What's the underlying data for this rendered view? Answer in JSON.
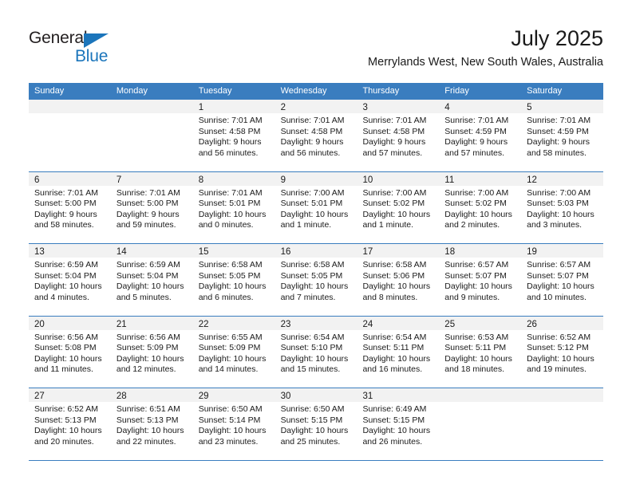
{
  "brand": {
    "name_top": "General",
    "name_bottom": "Blue",
    "triangle_icon": "triangle-icon",
    "color_dark": "#231f20",
    "color_blue": "#1b75bb"
  },
  "header": {
    "title": "July 2025",
    "subtitle": "Merrylands West, New South Wales, Australia"
  },
  "theme": {
    "header_blue": "#3a7dbf",
    "daynum_strip": "#f2f2f2",
    "text": "#1a1a1a"
  },
  "weekdays": [
    "Sunday",
    "Monday",
    "Tuesday",
    "Wednesday",
    "Thursday",
    "Friday",
    "Saturday"
  ],
  "weeks": [
    {
      "days": [
        {
          "num": "",
          "sunrise": "",
          "sunset": "",
          "daylight_l1": "",
          "daylight_l2": ""
        },
        {
          "num": "",
          "sunrise": "",
          "sunset": "",
          "daylight_l1": "",
          "daylight_l2": ""
        },
        {
          "num": "1",
          "sunrise": "Sunrise: 7:01 AM",
          "sunset": "Sunset: 4:58 PM",
          "daylight_l1": "Daylight: 9 hours",
          "daylight_l2": "and 56 minutes."
        },
        {
          "num": "2",
          "sunrise": "Sunrise: 7:01 AM",
          "sunset": "Sunset: 4:58 PM",
          "daylight_l1": "Daylight: 9 hours",
          "daylight_l2": "and 56 minutes."
        },
        {
          "num": "3",
          "sunrise": "Sunrise: 7:01 AM",
          "sunset": "Sunset: 4:58 PM",
          "daylight_l1": "Daylight: 9 hours",
          "daylight_l2": "and 57 minutes."
        },
        {
          "num": "4",
          "sunrise": "Sunrise: 7:01 AM",
          "sunset": "Sunset: 4:59 PM",
          "daylight_l1": "Daylight: 9 hours",
          "daylight_l2": "and 57 minutes."
        },
        {
          "num": "5",
          "sunrise": "Sunrise: 7:01 AM",
          "sunset": "Sunset: 4:59 PM",
          "daylight_l1": "Daylight: 9 hours",
          "daylight_l2": "and 58 minutes."
        }
      ]
    },
    {
      "days": [
        {
          "num": "6",
          "sunrise": "Sunrise: 7:01 AM",
          "sunset": "Sunset: 5:00 PM",
          "daylight_l1": "Daylight: 9 hours",
          "daylight_l2": "and 58 minutes."
        },
        {
          "num": "7",
          "sunrise": "Sunrise: 7:01 AM",
          "sunset": "Sunset: 5:00 PM",
          "daylight_l1": "Daylight: 9 hours",
          "daylight_l2": "and 59 minutes."
        },
        {
          "num": "8",
          "sunrise": "Sunrise: 7:01 AM",
          "sunset": "Sunset: 5:01 PM",
          "daylight_l1": "Daylight: 10 hours",
          "daylight_l2": "and 0 minutes."
        },
        {
          "num": "9",
          "sunrise": "Sunrise: 7:00 AM",
          "sunset": "Sunset: 5:01 PM",
          "daylight_l1": "Daylight: 10 hours",
          "daylight_l2": "and 1 minute."
        },
        {
          "num": "10",
          "sunrise": "Sunrise: 7:00 AM",
          "sunset": "Sunset: 5:02 PM",
          "daylight_l1": "Daylight: 10 hours",
          "daylight_l2": "and 1 minute."
        },
        {
          "num": "11",
          "sunrise": "Sunrise: 7:00 AM",
          "sunset": "Sunset: 5:02 PM",
          "daylight_l1": "Daylight: 10 hours",
          "daylight_l2": "and 2 minutes."
        },
        {
          "num": "12",
          "sunrise": "Sunrise: 7:00 AM",
          "sunset": "Sunset: 5:03 PM",
          "daylight_l1": "Daylight: 10 hours",
          "daylight_l2": "and 3 minutes."
        }
      ]
    },
    {
      "days": [
        {
          "num": "13",
          "sunrise": "Sunrise: 6:59 AM",
          "sunset": "Sunset: 5:04 PM",
          "daylight_l1": "Daylight: 10 hours",
          "daylight_l2": "and 4 minutes."
        },
        {
          "num": "14",
          "sunrise": "Sunrise: 6:59 AM",
          "sunset": "Sunset: 5:04 PM",
          "daylight_l1": "Daylight: 10 hours",
          "daylight_l2": "and 5 minutes."
        },
        {
          "num": "15",
          "sunrise": "Sunrise: 6:58 AM",
          "sunset": "Sunset: 5:05 PM",
          "daylight_l1": "Daylight: 10 hours",
          "daylight_l2": "and 6 minutes."
        },
        {
          "num": "16",
          "sunrise": "Sunrise: 6:58 AM",
          "sunset": "Sunset: 5:05 PM",
          "daylight_l1": "Daylight: 10 hours",
          "daylight_l2": "and 7 minutes."
        },
        {
          "num": "17",
          "sunrise": "Sunrise: 6:58 AM",
          "sunset": "Sunset: 5:06 PM",
          "daylight_l1": "Daylight: 10 hours",
          "daylight_l2": "and 8 minutes."
        },
        {
          "num": "18",
          "sunrise": "Sunrise: 6:57 AM",
          "sunset": "Sunset: 5:07 PM",
          "daylight_l1": "Daylight: 10 hours",
          "daylight_l2": "and 9 minutes."
        },
        {
          "num": "19",
          "sunrise": "Sunrise: 6:57 AM",
          "sunset": "Sunset: 5:07 PM",
          "daylight_l1": "Daylight: 10 hours",
          "daylight_l2": "and 10 minutes."
        }
      ]
    },
    {
      "days": [
        {
          "num": "20",
          "sunrise": "Sunrise: 6:56 AM",
          "sunset": "Sunset: 5:08 PM",
          "daylight_l1": "Daylight: 10 hours",
          "daylight_l2": "and 11 minutes."
        },
        {
          "num": "21",
          "sunrise": "Sunrise: 6:56 AM",
          "sunset": "Sunset: 5:09 PM",
          "daylight_l1": "Daylight: 10 hours",
          "daylight_l2": "and 12 minutes."
        },
        {
          "num": "22",
          "sunrise": "Sunrise: 6:55 AM",
          "sunset": "Sunset: 5:09 PM",
          "daylight_l1": "Daylight: 10 hours",
          "daylight_l2": "and 14 minutes."
        },
        {
          "num": "23",
          "sunrise": "Sunrise: 6:54 AM",
          "sunset": "Sunset: 5:10 PM",
          "daylight_l1": "Daylight: 10 hours",
          "daylight_l2": "and 15 minutes."
        },
        {
          "num": "24",
          "sunrise": "Sunrise: 6:54 AM",
          "sunset": "Sunset: 5:11 PM",
          "daylight_l1": "Daylight: 10 hours",
          "daylight_l2": "and 16 minutes."
        },
        {
          "num": "25",
          "sunrise": "Sunrise: 6:53 AM",
          "sunset": "Sunset: 5:11 PM",
          "daylight_l1": "Daylight: 10 hours",
          "daylight_l2": "and 18 minutes."
        },
        {
          "num": "26",
          "sunrise": "Sunrise: 6:52 AM",
          "sunset": "Sunset: 5:12 PM",
          "daylight_l1": "Daylight: 10 hours",
          "daylight_l2": "and 19 minutes."
        }
      ]
    },
    {
      "days": [
        {
          "num": "27",
          "sunrise": "Sunrise: 6:52 AM",
          "sunset": "Sunset: 5:13 PM",
          "daylight_l1": "Daylight: 10 hours",
          "daylight_l2": "and 20 minutes."
        },
        {
          "num": "28",
          "sunrise": "Sunrise: 6:51 AM",
          "sunset": "Sunset: 5:13 PM",
          "daylight_l1": "Daylight: 10 hours",
          "daylight_l2": "and 22 minutes."
        },
        {
          "num": "29",
          "sunrise": "Sunrise: 6:50 AM",
          "sunset": "Sunset: 5:14 PM",
          "daylight_l1": "Daylight: 10 hours",
          "daylight_l2": "and 23 minutes."
        },
        {
          "num": "30",
          "sunrise": "Sunrise: 6:50 AM",
          "sunset": "Sunset: 5:15 PM",
          "daylight_l1": "Daylight: 10 hours",
          "daylight_l2": "and 25 minutes."
        },
        {
          "num": "31",
          "sunrise": "Sunrise: 6:49 AM",
          "sunset": "Sunset: 5:15 PM",
          "daylight_l1": "Daylight: 10 hours",
          "daylight_l2": "and 26 minutes."
        },
        {
          "num": "",
          "sunrise": "",
          "sunset": "",
          "daylight_l1": "",
          "daylight_l2": ""
        },
        {
          "num": "",
          "sunrise": "",
          "sunset": "",
          "daylight_l1": "",
          "daylight_l2": ""
        }
      ]
    }
  ]
}
